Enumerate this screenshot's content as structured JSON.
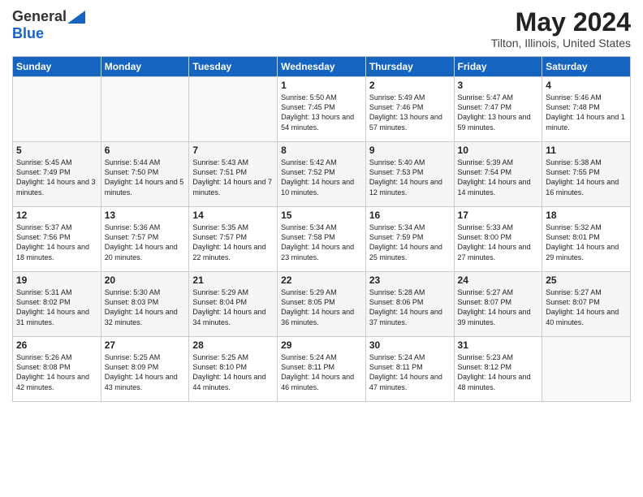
{
  "header": {
    "logo_general": "General",
    "logo_blue": "Blue",
    "month_year": "May 2024",
    "location": "Tilton, Illinois, United States"
  },
  "days_of_week": [
    "Sunday",
    "Monday",
    "Tuesday",
    "Wednesday",
    "Thursday",
    "Friday",
    "Saturday"
  ],
  "weeks": [
    [
      {
        "day": "",
        "sunrise": "",
        "sunset": "",
        "daylight": ""
      },
      {
        "day": "",
        "sunrise": "",
        "sunset": "",
        "daylight": ""
      },
      {
        "day": "",
        "sunrise": "",
        "sunset": "",
        "daylight": ""
      },
      {
        "day": "1",
        "sunrise": "Sunrise: 5:50 AM",
        "sunset": "Sunset: 7:45 PM",
        "daylight": "Daylight: 13 hours and 54 minutes."
      },
      {
        "day": "2",
        "sunrise": "Sunrise: 5:49 AM",
        "sunset": "Sunset: 7:46 PM",
        "daylight": "Daylight: 13 hours and 57 minutes."
      },
      {
        "day": "3",
        "sunrise": "Sunrise: 5:47 AM",
        "sunset": "Sunset: 7:47 PM",
        "daylight": "Daylight: 13 hours and 59 minutes."
      },
      {
        "day": "4",
        "sunrise": "Sunrise: 5:46 AM",
        "sunset": "Sunset: 7:48 PM",
        "daylight": "Daylight: 14 hours and 1 minute."
      }
    ],
    [
      {
        "day": "5",
        "sunrise": "Sunrise: 5:45 AM",
        "sunset": "Sunset: 7:49 PM",
        "daylight": "Daylight: 14 hours and 3 minutes."
      },
      {
        "day": "6",
        "sunrise": "Sunrise: 5:44 AM",
        "sunset": "Sunset: 7:50 PM",
        "daylight": "Daylight: 14 hours and 5 minutes."
      },
      {
        "day": "7",
        "sunrise": "Sunrise: 5:43 AM",
        "sunset": "Sunset: 7:51 PM",
        "daylight": "Daylight: 14 hours and 7 minutes."
      },
      {
        "day": "8",
        "sunrise": "Sunrise: 5:42 AM",
        "sunset": "Sunset: 7:52 PM",
        "daylight": "Daylight: 14 hours and 10 minutes."
      },
      {
        "day": "9",
        "sunrise": "Sunrise: 5:40 AM",
        "sunset": "Sunset: 7:53 PM",
        "daylight": "Daylight: 14 hours and 12 minutes."
      },
      {
        "day": "10",
        "sunrise": "Sunrise: 5:39 AM",
        "sunset": "Sunset: 7:54 PM",
        "daylight": "Daylight: 14 hours and 14 minutes."
      },
      {
        "day": "11",
        "sunrise": "Sunrise: 5:38 AM",
        "sunset": "Sunset: 7:55 PM",
        "daylight": "Daylight: 14 hours and 16 minutes."
      }
    ],
    [
      {
        "day": "12",
        "sunrise": "Sunrise: 5:37 AM",
        "sunset": "Sunset: 7:56 PM",
        "daylight": "Daylight: 14 hours and 18 minutes."
      },
      {
        "day": "13",
        "sunrise": "Sunrise: 5:36 AM",
        "sunset": "Sunset: 7:57 PM",
        "daylight": "Daylight: 14 hours and 20 minutes."
      },
      {
        "day": "14",
        "sunrise": "Sunrise: 5:35 AM",
        "sunset": "Sunset: 7:57 PM",
        "daylight": "Daylight: 14 hours and 22 minutes."
      },
      {
        "day": "15",
        "sunrise": "Sunrise: 5:34 AM",
        "sunset": "Sunset: 7:58 PM",
        "daylight": "Daylight: 14 hours and 23 minutes."
      },
      {
        "day": "16",
        "sunrise": "Sunrise: 5:34 AM",
        "sunset": "Sunset: 7:59 PM",
        "daylight": "Daylight: 14 hours and 25 minutes."
      },
      {
        "day": "17",
        "sunrise": "Sunrise: 5:33 AM",
        "sunset": "Sunset: 8:00 PM",
        "daylight": "Daylight: 14 hours and 27 minutes."
      },
      {
        "day": "18",
        "sunrise": "Sunrise: 5:32 AM",
        "sunset": "Sunset: 8:01 PM",
        "daylight": "Daylight: 14 hours and 29 minutes."
      }
    ],
    [
      {
        "day": "19",
        "sunrise": "Sunrise: 5:31 AM",
        "sunset": "Sunset: 8:02 PM",
        "daylight": "Daylight: 14 hours and 31 minutes."
      },
      {
        "day": "20",
        "sunrise": "Sunrise: 5:30 AM",
        "sunset": "Sunset: 8:03 PM",
        "daylight": "Daylight: 14 hours and 32 minutes."
      },
      {
        "day": "21",
        "sunrise": "Sunrise: 5:29 AM",
        "sunset": "Sunset: 8:04 PM",
        "daylight": "Daylight: 14 hours and 34 minutes."
      },
      {
        "day": "22",
        "sunrise": "Sunrise: 5:29 AM",
        "sunset": "Sunset: 8:05 PM",
        "daylight": "Daylight: 14 hours and 36 minutes."
      },
      {
        "day": "23",
        "sunrise": "Sunrise: 5:28 AM",
        "sunset": "Sunset: 8:06 PM",
        "daylight": "Daylight: 14 hours and 37 minutes."
      },
      {
        "day": "24",
        "sunrise": "Sunrise: 5:27 AM",
        "sunset": "Sunset: 8:07 PM",
        "daylight": "Daylight: 14 hours and 39 minutes."
      },
      {
        "day": "25",
        "sunrise": "Sunrise: 5:27 AM",
        "sunset": "Sunset: 8:07 PM",
        "daylight": "Daylight: 14 hours and 40 minutes."
      }
    ],
    [
      {
        "day": "26",
        "sunrise": "Sunrise: 5:26 AM",
        "sunset": "Sunset: 8:08 PM",
        "daylight": "Daylight: 14 hours and 42 minutes."
      },
      {
        "day": "27",
        "sunrise": "Sunrise: 5:25 AM",
        "sunset": "Sunset: 8:09 PM",
        "daylight": "Daylight: 14 hours and 43 minutes."
      },
      {
        "day": "28",
        "sunrise": "Sunrise: 5:25 AM",
        "sunset": "Sunset: 8:10 PM",
        "daylight": "Daylight: 14 hours and 44 minutes."
      },
      {
        "day": "29",
        "sunrise": "Sunrise: 5:24 AM",
        "sunset": "Sunset: 8:11 PM",
        "daylight": "Daylight: 14 hours and 46 minutes."
      },
      {
        "day": "30",
        "sunrise": "Sunrise: 5:24 AM",
        "sunset": "Sunset: 8:11 PM",
        "daylight": "Daylight: 14 hours and 47 minutes."
      },
      {
        "day": "31",
        "sunrise": "Sunrise: 5:23 AM",
        "sunset": "Sunset: 8:12 PM",
        "daylight": "Daylight: 14 hours and 48 minutes."
      },
      {
        "day": "",
        "sunrise": "",
        "sunset": "",
        "daylight": ""
      }
    ]
  ]
}
